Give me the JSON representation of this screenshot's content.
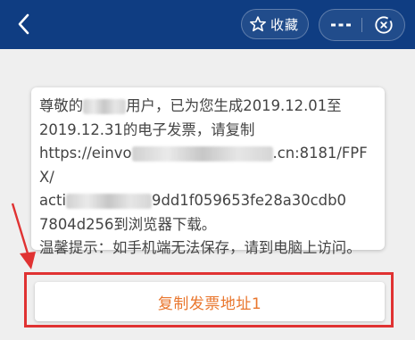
{
  "header": {
    "favorite_label": "收藏",
    "background": "#0f3d82",
    "icons": {
      "back": "chevron-left-icon",
      "favorite": "star-outline-icon",
      "more": "more-dots-icon",
      "close": "close-circle-icon"
    }
  },
  "message": {
    "line1_prefix": "尊敬的",
    "line1_suffix": "用户，已为您生成2019.12.01至",
    "line2": "2019.12.31的电子发票，请复制",
    "line3_prefix": "https://einvo",
    "line3_suffix": ".cn:8181/FPFX/",
    "line4_prefix": "acti",
    "line4_suffix": "9dd1f059653fe28a30cdb0",
    "line5": "7804d256到浏览器下载。",
    "tip": "温馨提示：如手机端无法保存，请到电脑上访问。"
  },
  "actions": {
    "copy_button_label": "复制发票地址1",
    "accent_color": "#e9762d"
  },
  "annotation": {
    "highlight_color": "#e03232"
  }
}
